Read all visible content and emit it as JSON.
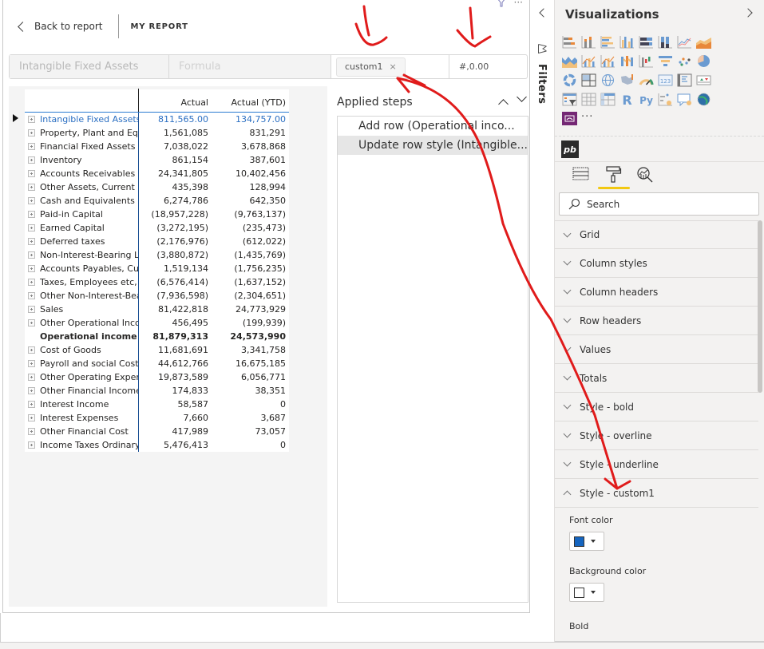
{
  "header": {
    "back_label": "Back to report",
    "report_name": "MY REPORT",
    "more_label": "···"
  },
  "formula_bar": {
    "row_name": "Intangible Fixed Assets",
    "formula_placeholder": "Formula",
    "style_chip": "custom1",
    "style_chip_remove": "×",
    "number_format": "#,0.00"
  },
  "matrix": {
    "columns": [
      "",
      "Actual",
      "Actual (YTD)"
    ],
    "rows": [
      {
        "label": "Intangible Fixed Assets",
        "actual": "811,565.00",
        "ytd": "134,757.00",
        "style": "custom"
      },
      {
        "label": "Property, Plant and Equipment",
        "actual": "1,561,085",
        "ytd": "831,291"
      },
      {
        "label": "Financial Fixed Assets",
        "actual": "7,038,022",
        "ytd": "3,678,868"
      },
      {
        "label": "Inventory",
        "actual": "861,154",
        "ytd": "387,601"
      },
      {
        "label": "Accounts Receivables",
        "actual": "24,341,805",
        "ytd": "10,402,456"
      },
      {
        "label": "Other Assets, Current",
        "actual": "435,398",
        "ytd": "128,994"
      },
      {
        "label": "Cash and Equivalents",
        "actual": "6,274,786",
        "ytd": "642,350"
      },
      {
        "label": "Paid-in Capital",
        "actual": "(18,957,228)",
        "ytd": "(9,763,137)"
      },
      {
        "label": "Earned Capital",
        "actual": "(3,272,195)",
        "ytd": "(235,473)"
      },
      {
        "label": "Deferred taxes",
        "actual": "(2,176,976)",
        "ytd": "(612,022)"
      },
      {
        "label": "Non-Interest-Bearing Liabilities",
        "actual": "(3,880,872)",
        "ytd": "(1,435,769)"
      },
      {
        "label": "Accounts Payables, Current",
        "actual": "1,519,134",
        "ytd": "(1,756,235)"
      },
      {
        "label": "Taxes, Employees etc, Current",
        "actual": "(6,576,414)",
        "ytd": "(1,637,152)"
      },
      {
        "label": "Other Non-Interest-Bearing",
        "actual": "(7,936,598)",
        "ytd": "(2,304,651)"
      },
      {
        "label": "Sales",
        "actual": "81,422,818",
        "ytd": "24,773,929"
      },
      {
        "label": "Other Operational Income",
        "actual": "456,495",
        "ytd": "(199,939)"
      },
      {
        "label": "Operational income",
        "actual": "81,879,313",
        "ytd": "24,573,990",
        "style": "bold"
      },
      {
        "label": "Cost of Goods",
        "actual": "11,681,691",
        "ytd": "3,341,758"
      },
      {
        "label": "Payroll and social Cost",
        "actual": "44,612,766",
        "ytd": "16,675,185"
      },
      {
        "label": "Other Operating Expenses",
        "actual": "19,873,589",
        "ytd": "6,056,771"
      },
      {
        "label": "Other Financial Income",
        "actual": "174,833",
        "ytd": "38,351"
      },
      {
        "label": "Interest Income",
        "actual": "58,587",
        "ytd": "0"
      },
      {
        "label": "Interest Expenses",
        "actual": "7,660",
        "ytd": "3,687"
      },
      {
        "label": "Other Financial Cost",
        "actual": "417,989",
        "ytd": "73,057"
      },
      {
        "label": "Income Taxes Ordinary",
        "actual": "5,476,413",
        "ytd": "0"
      }
    ]
  },
  "applied_steps": {
    "title": "Applied steps",
    "steps": [
      {
        "label": "Add row (Operational inco...",
        "selected": false
      },
      {
        "label": "Update row style (Intangible...",
        "selected": true
      }
    ]
  },
  "filters": {
    "label": "Filters"
  },
  "visualizations": {
    "title": "Visualizations",
    "icons": [
      "stacked-bar-chart-icon",
      "stacked-column-chart-icon",
      "clustered-bar-chart-icon",
      "clustered-column-chart-icon",
      "100-stacked-bar-chart-icon",
      "100-stacked-column-chart-icon",
      "line-chart-icon",
      "area-chart-icon",
      "stacked-area-chart-icon",
      "line-and-stacked-column-chart-icon",
      "line-and-clustered-column-chart-icon",
      "ribbon-chart-icon",
      "waterfall-chart-icon",
      "funnel-chart-icon",
      "scatter-chart-icon",
      "pie-chart-icon",
      "donut-chart-icon",
      "treemap-icon",
      "map-icon",
      "filled-map-icon",
      "gauge-icon",
      "card-icon",
      "multi-row-card-icon",
      "kpi-icon",
      "slicer-icon",
      "table-icon",
      "matrix-icon",
      "r-script-visual-icon",
      "python-visual-icon",
      "key-influencers-icon",
      "qa-visual-icon",
      "arcgis-map-icon",
      "power-apps-icon"
    ],
    "more_label": "···",
    "custom_visual": "pb",
    "search_placeholder": "Search",
    "sections": [
      {
        "label": "Grid",
        "expanded": false
      },
      {
        "label": "Column styles",
        "expanded": false
      },
      {
        "label": "Column headers",
        "expanded": false
      },
      {
        "label": "Row headers",
        "expanded": false
      },
      {
        "label": "Values",
        "expanded": false
      },
      {
        "label": "Totals",
        "expanded": false
      },
      {
        "label": "Style - bold",
        "expanded": false
      },
      {
        "label": "Style - overline",
        "expanded": false
      },
      {
        "label": "Style - underline",
        "expanded": false
      },
      {
        "label": "Style - custom1",
        "expanded": true
      }
    ],
    "custom1": {
      "font_color_label": "Font color",
      "font_color": "#1565c0",
      "background_color_label": "Background color",
      "background_color": "#ffffff",
      "bold_label": "Bold"
    }
  },
  "colors": {
    "accent_blue": "#2b6fc2",
    "active_tab_underline": "#f2c811",
    "annotation_red": "#e01b1b"
  }
}
